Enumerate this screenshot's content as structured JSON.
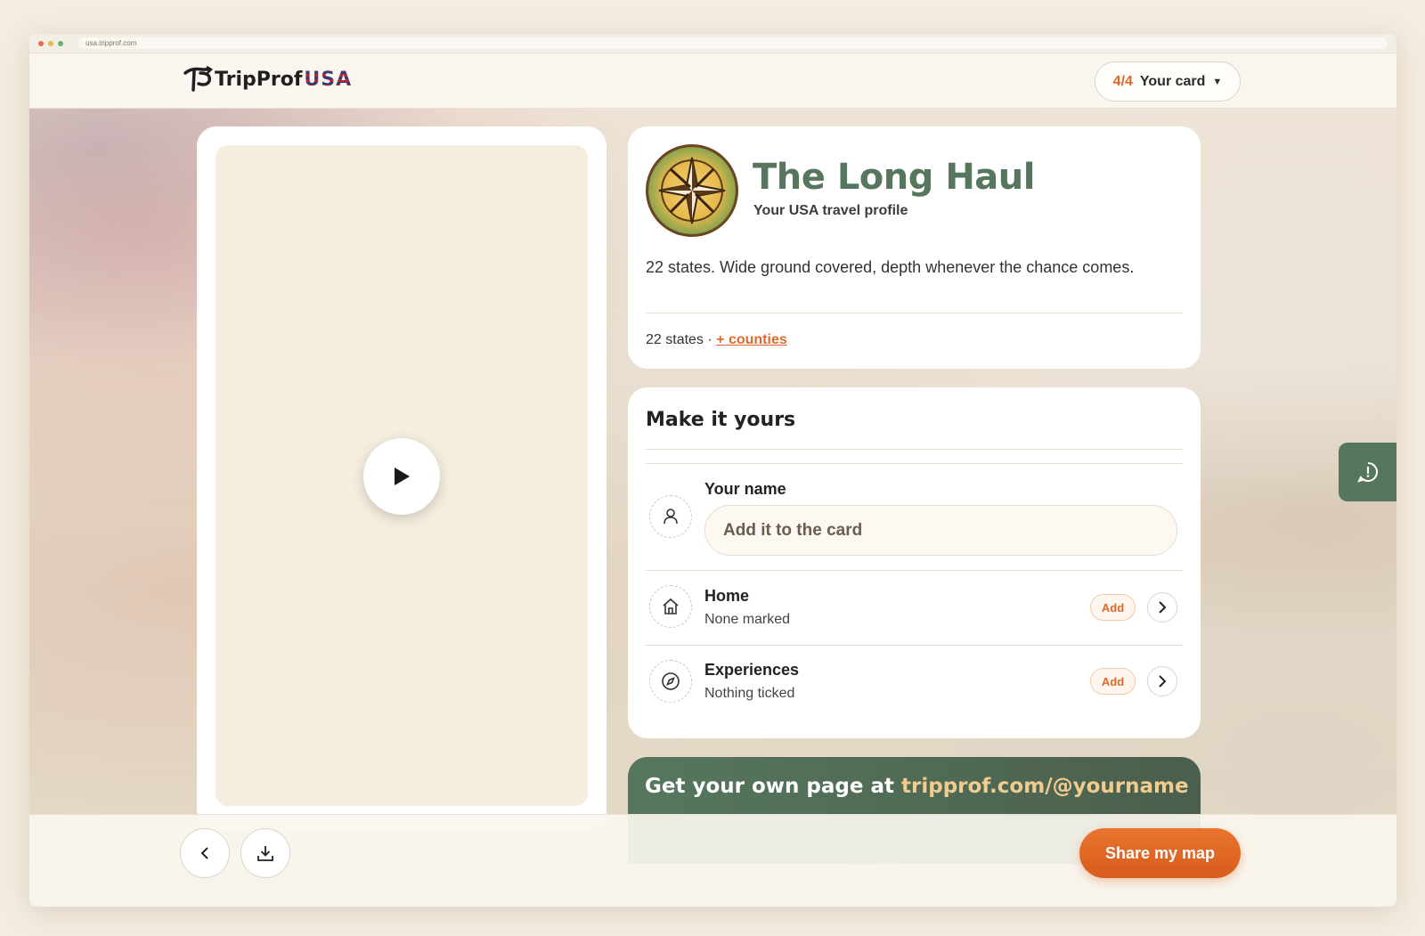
{
  "browser": {
    "url": "usa.tripprof.com",
    "dots": [
      "#e86a4f",
      "#e9b84a",
      "#6bae6a"
    ]
  },
  "header": {
    "logo_main": "TripProf",
    "logo_suffix": "USA",
    "card_count": "4/4",
    "card_label": "Your card"
  },
  "profile": {
    "title": "The Long Haul",
    "subtitle": "Your USA travel profile",
    "description": "22 states. Wide ground covered, depth whenever the chance comes.",
    "stats_prefix": "22 states ·",
    "stats_link": "+ counties"
  },
  "make_it_yours": {
    "title": "Make it yours",
    "name": {
      "label": "Your name",
      "placeholder": "Add it to the card"
    },
    "home": {
      "label": "Home",
      "status": "None marked",
      "add_label": "Add"
    },
    "experiences": {
      "label": "Experiences",
      "status": "Nothing ticked",
      "add_label": "Add"
    }
  },
  "promo": {
    "text": "Get your own page at",
    "handle": "tripprof.com/@yourname"
  },
  "footer": {
    "share_label": "Share my map"
  },
  "colors": {
    "accent": "#dc6a2c",
    "green": "#56775d"
  }
}
